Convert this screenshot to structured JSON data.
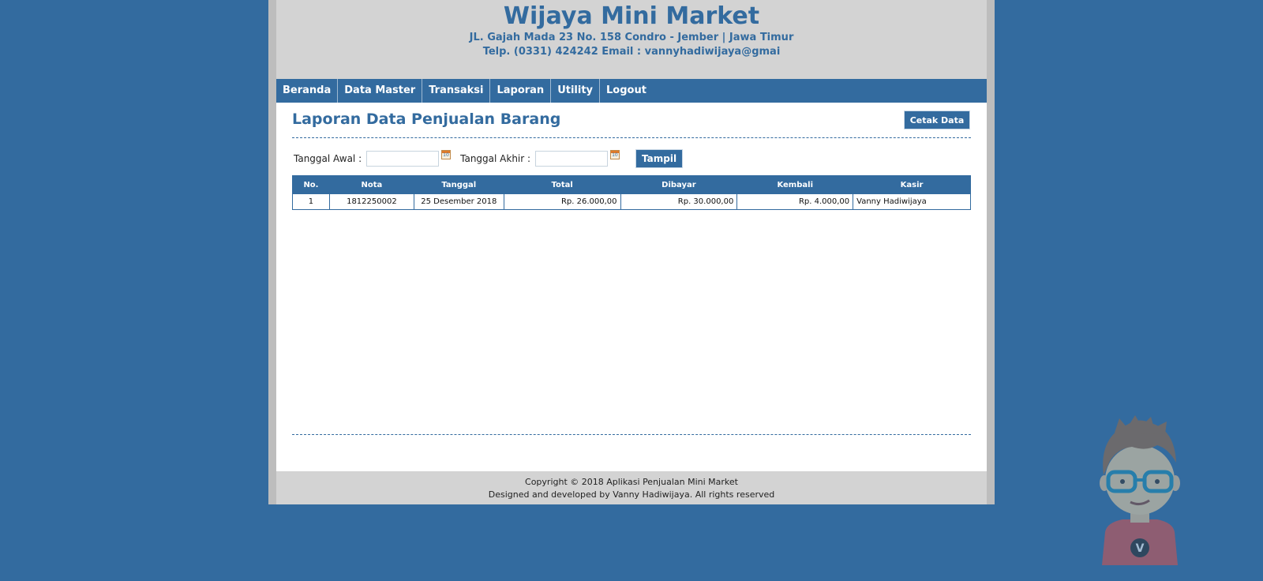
{
  "header": {
    "title": "Wijaya Mini Market",
    "address": "JL. Gajah Mada 23 No. 158 Condro - Jember | Jawa Timur",
    "contact": "Telp. (0331) 424242 Email : vannyhadiwijaya@gmai"
  },
  "nav": [
    "Beranda",
    "Data Master",
    "Transaksi",
    "Laporan",
    "Utility",
    "Logout"
  ],
  "page": {
    "title": "Laporan Data Penjualan Barang",
    "print_button": "Cetak Data"
  },
  "filter": {
    "start_label": "Tanggal Awal :",
    "start_value": "",
    "end_label": "Tanggal Akhir :",
    "end_value": "",
    "show_button": "Tampil"
  },
  "table": {
    "columns": [
      "No.",
      "Nota",
      "Tanggal",
      "Total",
      "Dibayar",
      "Kembali",
      "Kasir"
    ],
    "rows": [
      [
        "1",
        "1812250002",
        "25 Desember 2018",
        "Rp. 26.000,00",
        "Rp. 30.000,00",
        "Rp. 4.000,00",
        "Vanny Hadiwijaya"
      ]
    ]
  },
  "footer": {
    "line1": "Copyright © 2018 Aplikasi Penjualan Mini Market",
    "line2": "Designed and developed by Vanny Hadiwijaya. All rights reserved"
  },
  "mascot": {
    "letter": "V",
    "icon": "mascot-avatar-icon"
  }
}
